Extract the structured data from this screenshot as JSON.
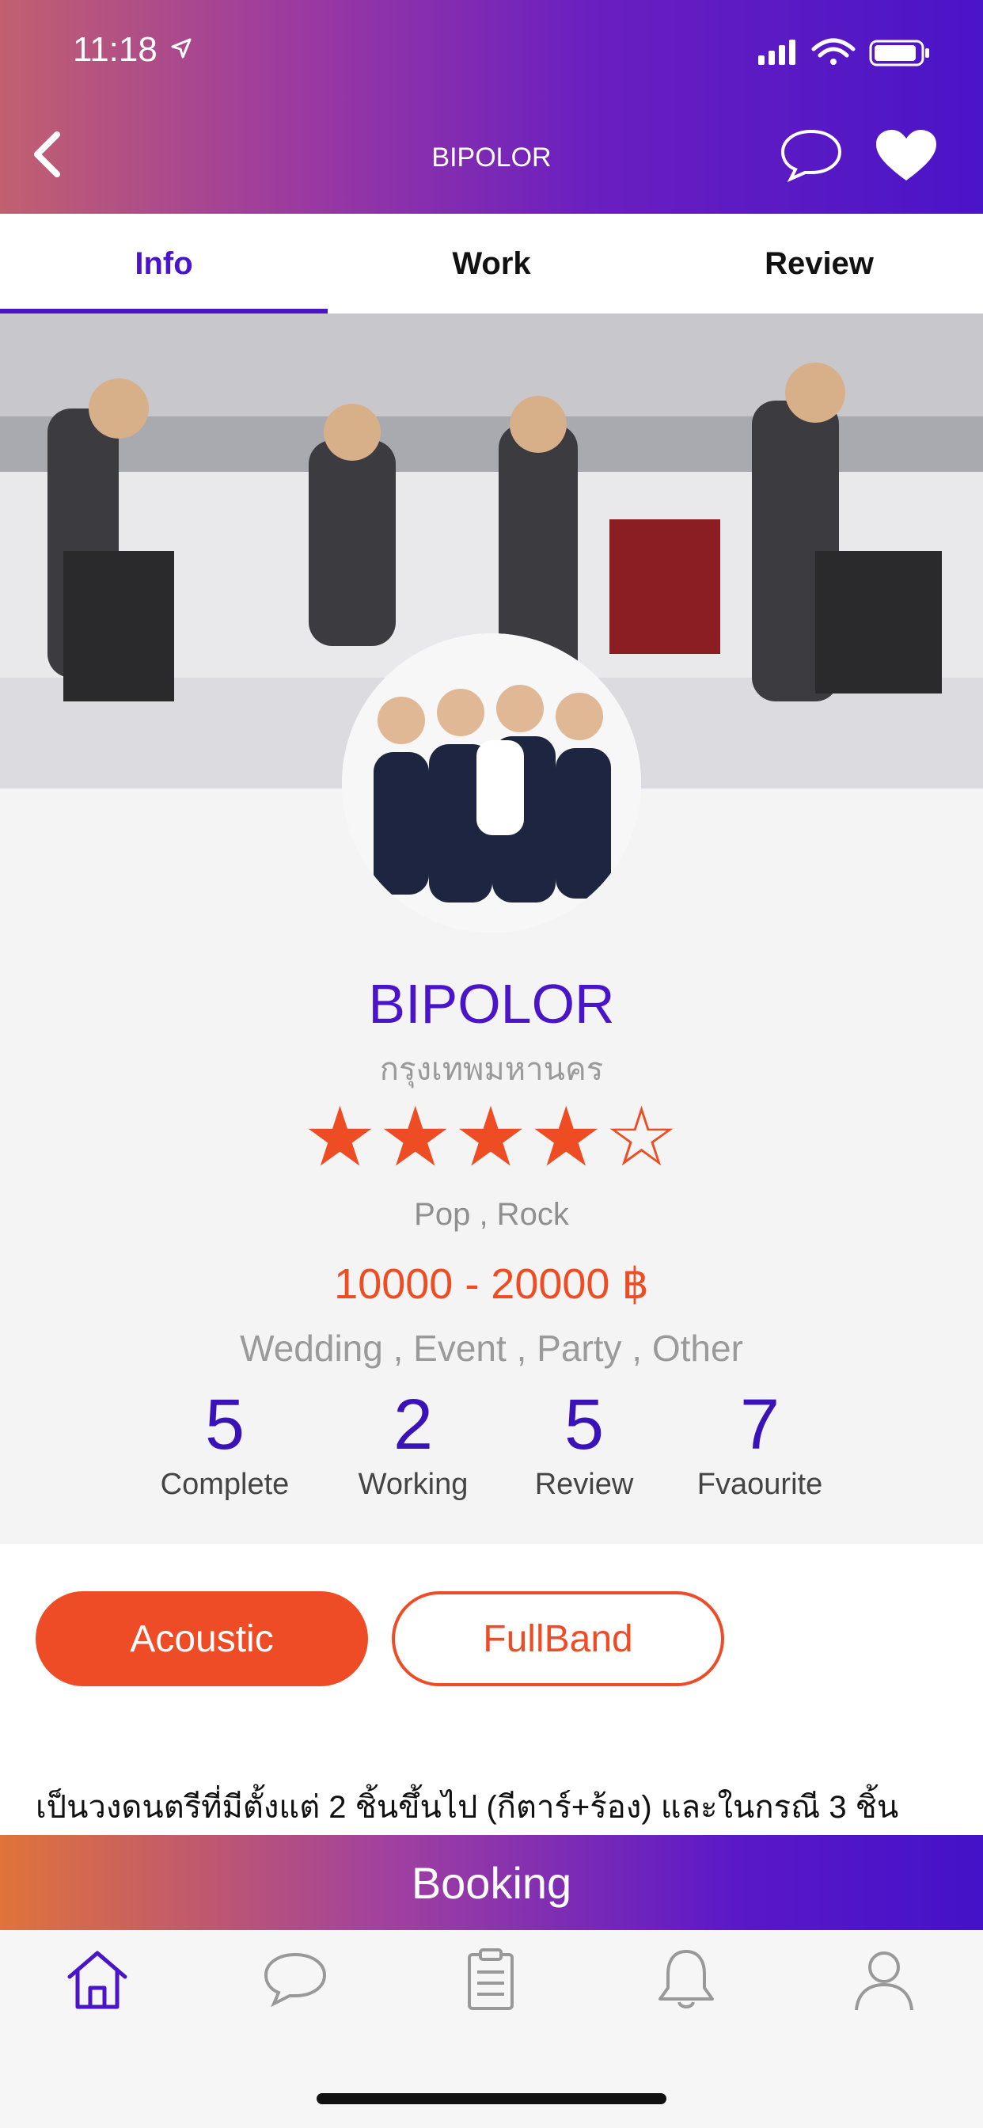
{
  "status_bar": {
    "time": "11:18"
  },
  "header": {
    "title": "BIPOLOR",
    "icons": [
      "back-icon",
      "chat-icon",
      "heart-icon"
    ],
    "gradient": [
      "#c26070",
      "#4a14c8"
    ]
  },
  "tabs": [
    {
      "label": "Info",
      "active": true
    },
    {
      "label": "Work",
      "active": false
    },
    {
      "label": "Review",
      "active": false
    }
  ],
  "profile": {
    "name": "BIPOLOR",
    "location": "กรุงเทพมหานคร",
    "rating": 4,
    "rating_max": 5,
    "genres": "Pop , Rock",
    "price": "10000 - 20000 ฿",
    "events": "Wedding , Event , Party , Other"
  },
  "stats": [
    {
      "value": "5",
      "label": "Complete"
    },
    {
      "value": "2",
      "label": "Working"
    },
    {
      "value": "5",
      "label": "Review"
    },
    {
      "value": "7",
      "label": "Fvaourite"
    }
  ],
  "styles": {
    "acoustic": "Acoustic",
    "fullband": "FullBand"
  },
  "description": "เป็นวงดนตรีที่มีตั้งแต่ 2 ชิ้นขึ้นไป (กีตาร์+ร้อง) และในกรณี 3 ชิ้น",
  "booking": {
    "label": "Booking"
  },
  "bottom_nav": [
    "home-icon",
    "chat-icon",
    "clipboard-icon",
    "bell-icon",
    "profile-icon"
  ],
  "colors": {
    "primary": "#4a14c8",
    "accent": "#ee4c26"
  }
}
